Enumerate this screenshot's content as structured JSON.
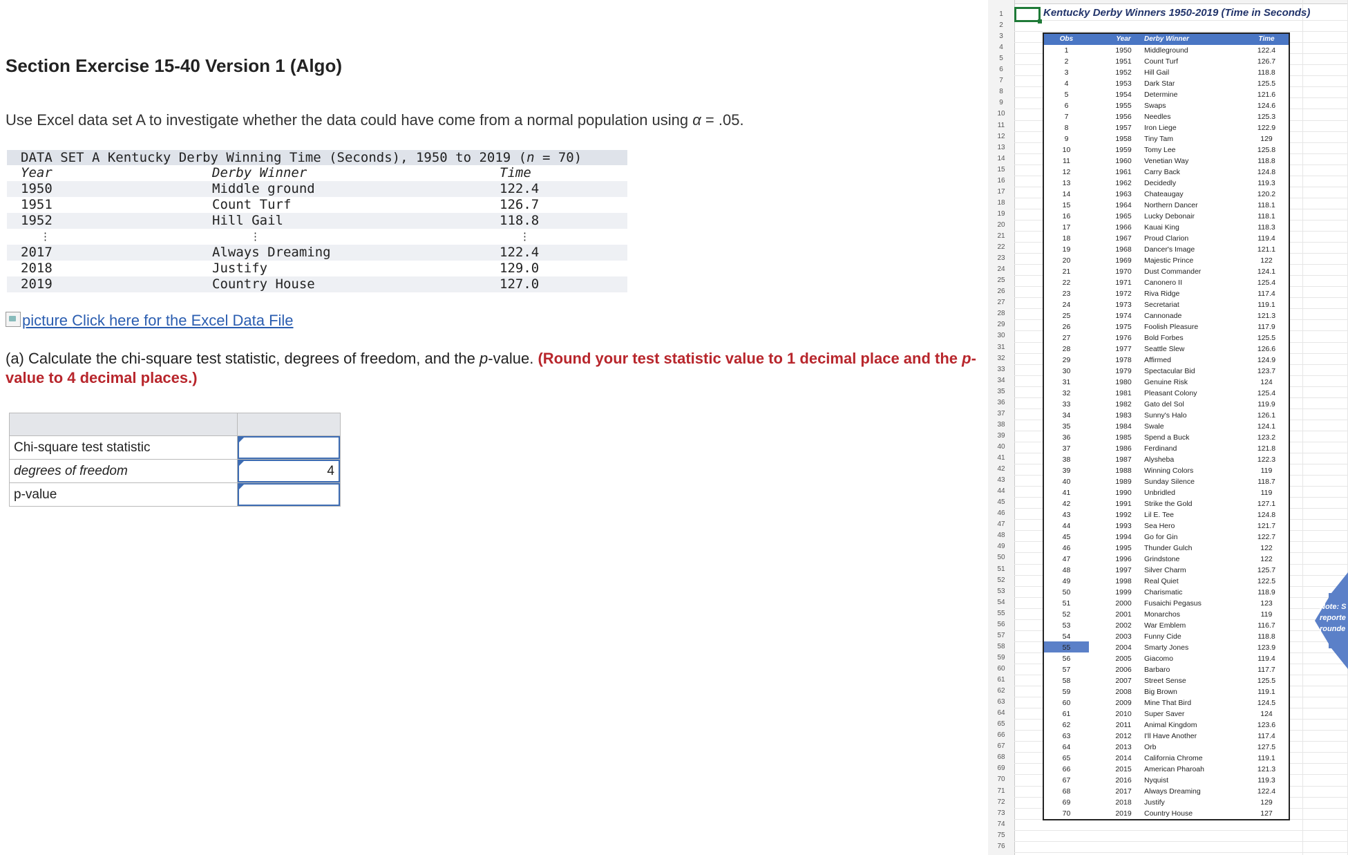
{
  "page": {
    "title": "Section Exercise 15-40 Version 1 (Algo)",
    "intro_prefix": "Use Excel data set A to investigate whether the data could have come from a normal population using ",
    "intro_alpha": "α",
    "intro_suffix": " = .05."
  },
  "dataset": {
    "caption_prefix": "DATA SET A Kentucky Derby Winning Time (Seconds), 1950 to 2019 (",
    "caption_n": "n",
    "caption_suffix": " = 70)",
    "headers": [
      "Year",
      "Derby Winner",
      "Time"
    ],
    "rows": [
      [
        "1950",
        "Middle ground",
        "122.4"
      ],
      [
        "1951",
        "Count Turf",
        "126.7"
      ],
      [
        "1952",
        "Hill Gail",
        "118.8"
      ],
      [
        "⋮",
        "⋮",
        "⋮"
      ],
      [
        "2017",
        "Always Dreaming",
        "122.4"
      ],
      [
        "2018",
        "Justify",
        "129.0"
      ],
      [
        "2019",
        "Country House",
        "127.0"
      ]
    ]
  },
  "excel_link": {
    "alt": "picture",
    "label": "Click here for the Excel Data File"
  },
  "question": {
    "prefix": "(a) Calculate the chi-square test statistic, degrees of freedom, and the ",
    "pvalue_word": "p",
    "middle": "-value. ",
    "red_1": "(Round your test statistic value to 1 decimal place and the ",
    "red_p": "p",
    "red_2": "-value to 4 decimal places.)"
  },
  "answer_table": {
    "rows": [
      {
        "label": "Chi-square test statistic",
        "value": ""
      },
      {
        "label": "degrees of freedom",
        "value": "4"
      },
      {
        "label": "p-value",
        "value": ""
      }
    ]
  },
  "spreadsheet": {
    "title": "Kentucky Derby Winners 1950-2019 (Time in Seconds)",
    "headers": [
      "Obs",
      "Year",
      "Derby Winner",
      "Time"
    ],
    "row_numbers": [
      "1",
      "2",
      "3",
      "4",
      "5",
      "6",
      "7",
      "8",
      "9",
      "10",
      "11",
      "12",
      "13",
      "14",
      "15",
      "16",
      "17",
      "18",
      "19",
      "20",
      "21",
      "22",
      "23",
      "24",
      "25",
      "26",
      "27",
      "28",
      "29",
      "30",
      "31",
      "32",
      "33",
      "34",
      "35",
      "36",
      "37",
      "38",
      "39",
      "40",
      "41",
      "42",
      "43",
      "44",
      "45",
      "46",
      "47",
      "48",
      "49",
      "50",
      "51",
      "52",
      "53",
      "54",
      "55",
      "56",
      "57",
      "58",
      "59",
      "60",
      "61",
      "62",
      "63",
      "64",
      "65",
      "66",
      "67",
      "68",
      "69",
      "70",
      "71",
      "72",
      "73",
      "74",
      "75",
      "76"
    ],
    "rows": [
      [
        "1",
        "1950",
        "Middleground",
        "122.4"
      ],
      [
        "2",
        "1951",
        "Count Turf",
        "126.7"
      ],
      [
        "3",
        "1952",
        "Hill Gail",
        "118.8"
      ],
      [
        "4",
        "1953",
        "Dark Star",
        "125.5"
      ],
      [
        "5",
        "1954",
        "Determine",
        "121.6"
      ],
      [
        "6",
        "1955",
        "Swaps",
        "124.6"
      ],
      [
        "7",
        "1956",
        "Needles",
        "125.3"
      ],
      [
        "8",
        "1957",
        "Iron Liege",
        "122.9"
      ],
      [
        "9",
        "1958",
        "Tiny Tam",
        "129"
      ],
      [
        "10",
        "1959",
        "Tomy Lee",
        "125.8"
      ],
      [
        "11",
        "1960",
        "Venetian Way",
        "118.8"
      ],
      [
        "12",
        "1961",
        "Carry Back",
        "124.8"
      ],
      [
        "13",
        "1962",
        "Decidedly",
        "119.3"
      ],
      [
        "14",
        "1963",
        "Chateaugay",
        "120.2"
      ],
      [
        "15",
        "1964",
        "Northern Dancer",
        "118.1"
      ],
      [
        "16",
        "1965",
        "Lucky Debonair",
        "118.1"
      ],
      [
        "17",
        "1966",
        "Kauai King",
        "118.3"
      ],
      [
        "18",
        "1967",
        "Proud Clarion",
        "119.4"
      ],
      [
        "19",
        "1968",
        "Dancer's Image",
        "121.1"
      ],
      [
        "20",
        "1969",
        "Majestic Prince",
        "122"
      ],
      [
        "21",
        "1970",
        "Dust Commander",
        "124.1"
      ],
      [
        "22",
        "1971",
        "Canonero II",
        "125.4"
      ],
      [
        "23",
        "1972",
        "Riva Ridge",
        "117.4"
      ],
      [
        "24",
        "1973",
        "Secretariat",
        "119.1"
      ],
      [
        "25",
        "1974",
        "Cannonade",
        "121.3"
      ],
      [
        "26",
        "1975",
        "Foolish Pleasure",
        "117.9"
      ],
      [
        "27",
        "1976",
        "Bold Forbes",
        "125.5"
      ],
      [
        "28",
        "1977",
        "Seattle Slew",
        "126.6"
      ],
      [
        "29",
        "1978",
        "Affirmed",
        "124.9"
      ],
      [
        "30",
        "1979",
        "Spectacular Bid",
        "123.7"
      ],
      [
        "31",
        "1980",
        "Genuine Risk",
        "124"
      ],
      [
        "32",
        "1981",
        "Pleasant Colony",
        "125.4"
      ],
      [
        "33",
        "1982",
        "Gato del Sol",
        "119.9"
      ],
      [
        "34",
        "1983",
        "Sunny's Halo",
        "126.1"
      ],
      [
        "35",
        "1984",
        "Swale",
        "124.1"
      ],
      [
        "36",
        "1985",
        "Spend a Buck",
        "123.2"
      ],
      [
        "37",
        "1986",
        "Ferdinand",
        "121.8"
      ],
      [
        "38",
        "1987",
        "Alysheba",
        "122.3"
      ],
      [
        "39",
        "1988",
        "Winning Colors",
        "119"
      ],
      [
        "40",
        "1989",
        "Sunday Silence",
        "118.7"
      ],
      [
        "41",
        "1990",
        "Unbridled",
        "119"
      ],
      [
        "42",
        "1991",
        "Strike the Gold",
        "127.1"
      ],
      [
        "43",
        "1992",
        "Lil E. Tee",
        "124.8"
      ],
      [
        "44",
        "1993",
        "Sea Hero",
        "121.7"
      ],
      [
        "45",
        "1994",
        "Go for Gin",
        "122.7"
      ],
      [
        "46",
        "1995",
        "Thunder Gulch",
        "122"
      ],
      [
        "47",
        "1996",
        "Grindstone",
        "122"
      ],
      [
        "48",
        "1997",
        "Silver Charm",
        "125.7"
      ],
      [
        "49",
        "1998",
        "Real Quiet",
        "122.5"
      ],
      [
        "50",
        "1999",
        "Charismatic",
        "118.9"
      ],
      [
        "51",
        "2000",
        "Fusaichi Pegasus",
        "123"
      ],
      [
        "52",
        "2001",
        "Monarchos",
        "119"
      ],
      [
        "53",
        "2002",
        "War Emblem",
        "116.7"
      ],
      [
        "54",
        "2003",
        "Funny Cide",
        "118.8"
      ],
      [
        "55",
        "2004",
        "Smarty Jones",
        "123.9"
      ],
      [
        "56",
        "2005",
        "Giacomo",
        "119.4"
      ],
      [
        "57",
        "2006",
        "Barbaro",
        "117.7"
      ],
      [
        "58",
        "2007",
        "Street Sense",
        "125.5"
      ],
      [
        "59",
        "2008",
        "Big Brown",
        "119.1"
      ],
      [
        "60",
        "2009",
        "Mine That Bird",
        "124.5"
      ],
      [
        "61",
        "2010",
        "Super Saver",
        "124"
      ],
      [
        "62",
        "2011",
        "Animal Kingdom",
        "123.6"
      ],
      [
        "63",
        "2012",
        "I'll Have Another",
        "117.4"
      ],
      [
        "64",
        "2013",
        "Orb",
        "127.5"
      ],
      [
        "65",
        "2014",
        "California Chrome",
        "119.1"
      ],
      [
        "66",
        "2015",
        "American Pharoah",
        "121.3"
      ],
      [
        "67",
        "2016",
        "Nyquist",
        "119.3"
      ],
      [
        "68",
        "2017",
        "Always Dreaming",
        "122.4"
      ],
      [
        "69",
        "2018",
        "Justify",
        "129"
      ],
      [
        "70",
        "2019",
        "Country House",
        "127"
      ]
    ],
    "note_lines": [
      "Note: S",
      "reporte",
      "rounde"
    ],
    "colors": {
      "header_blue": "#4a76c4",
      "selection_green": "#1f7a38",
      "note_arrow": "#5b80c8"
    }
  }
}
